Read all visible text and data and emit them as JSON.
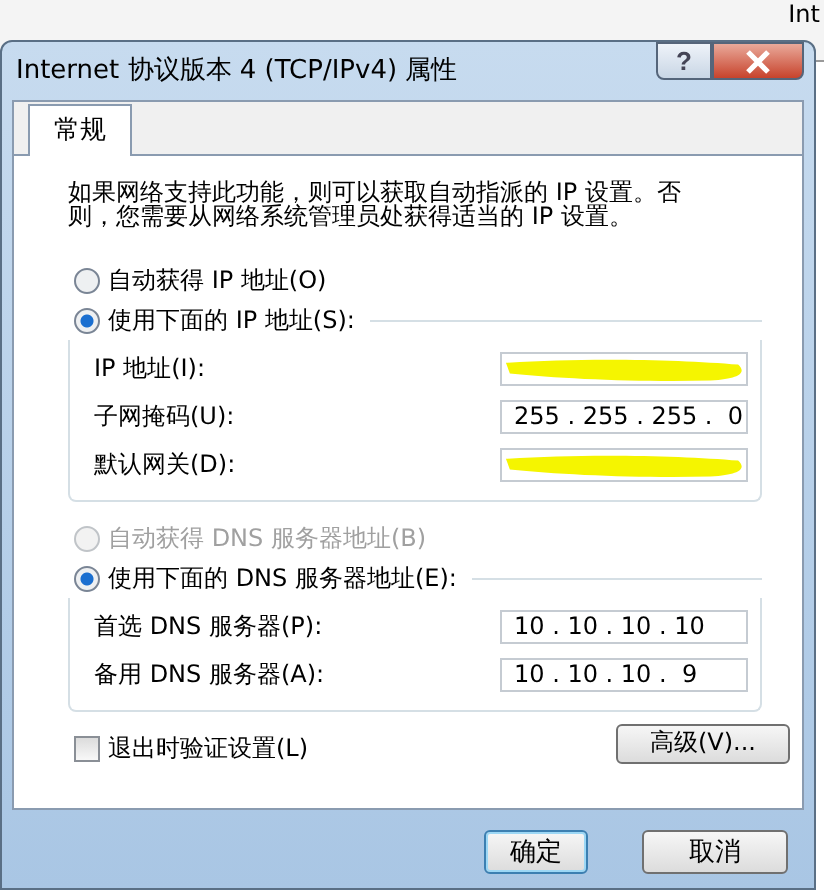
{
  "background_window": {
    "texts": [
      "Int"
    ]
  },
  "window": {
    "title": "Internet 协议版本 4 (TCP/IPv4) 属性",
    "help": "?"
  },
  "tabs": [
    {
      "label": "常规",
      "selected": true
    }
  ],
  "description": "如果网络支持此功能，则可以获取自动指派的 IP 设置。否则，您需要从网络系统管理员处获得适当的 IP 设置。",
  "ip": {
    "options": [
      {
        "label": "自动获得 IP 地址(O)",
        "selected": false,
        "disabled": false
      },
      {
        "label": "使用下面的 IP 地址(S):",
        "selected": true,
        "disabled": false
      }
    ],
    "fields": [
      {
        "label": "IP 地址(I):",
        "redacted": true
      },
      {
        "label": "子网掩码(U):",
        "value": "255 . 255 . 255 .  0",
        "redacted": false
      },
      {
        "label": "默认网关(D):",
        "redacted": true
      }
    ]
  },
  "dns": {
    "options": [
      {
        "label": "自动获得 DNS 服务器地址(B)",
        "selected": false,
        "disabled": true
      },
      {
        "label": "使用下面的 DNS 服务器地址(E):",
        "selected": true,
        "disabled": false
      }
    ],
    "fields": [
      {
        "label": "首选 DNS 服务器(P):",
        "value": "10 . 10 . 10 . 10",
        "redacted": false
      },
      {
        "label": "备用 DNS 服务器(A):",
        "value": "10 . 10 . 10 .  9",
        "redacted": false
      }
    ]
  },
  "validate_on_exit": {
    "label": "退出时验证设置(L)",
    "checked": false
  },
  "advanced_button": "高级(V)...",
  "buttons": [
    {
      "label": "确定",
      "default": true
    },
    {
      "label": "取消",
      "default": false
    }
  ]
}
